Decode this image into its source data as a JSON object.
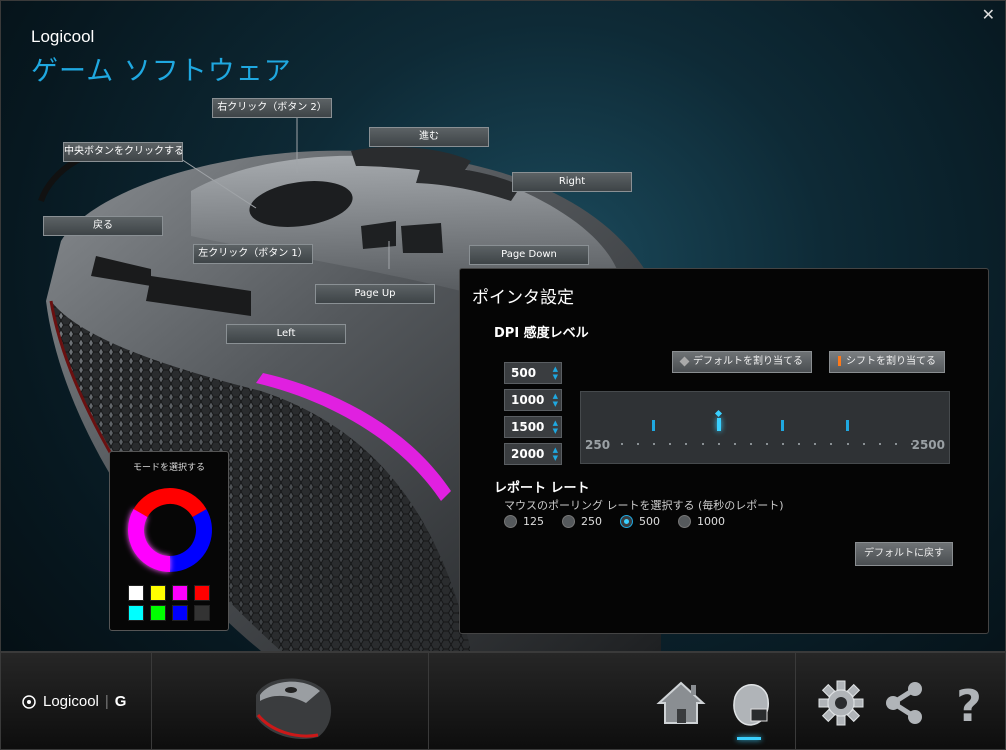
{
  "window": {
    "close_label": "✕"
  },
  "brand": {
    "company": "Logicool",
    "product": "ゲーム ソフトウェア"
  },
  "callouts": {
    "right_click": "右クリック（ボタン 2）",
    "forward": "進む",
    "middle_click": "中央ボタンをクリックする (7",
    "right": "Right",
    "back": "戻る",
    "left_click": "左クリック（ボタン 1）",
    "page_down": "Page Down",
    "page_up": "Page Up",
    "left": "Left"
  },
  "panel": {
    "title": "ポインタ設定",
    "dpi_title": "DPI 感度レベル",
    "assign_default_label": "デフォルトを割り当てる",
    "assign_shift_label": "シフトを割り当てる",
    "dpi_levels": [
      "500",
      "1000",
      "1500",
      "2000"
    ],
    "slider": {
      "min_label": "250",
      "max_label": "2500",
      "min": 250,
      "max": 2500,
      "step": 125,
      "levels": [
        500,
        1000,
        1500,
        2000
      ],
      "selected": 1000
    },
    "report_title": "レポート レート",
    "report_subtitle": "マウスのポーリング レートを選択する (毎秒のレポート)",
    "report_options": [
      "125",
      "250",
      "500",
      "1000"
    ],
    "report_selected": "500",
    "reset_label": "デフォルトに戻す"
  },
  "mode": {
    "title": "モードを選択する",
    "swatches": [
      "#ffffff",
      "#ffff00",
      "#ff00ff",
      "#ff0000",
      "#00ffff",
      "#00ff00",
      "#0000ff",
      "#333333"
    ]
  },
  "bottom": {
    "logo_text": "Logicool",
    "logo_g": "G",
    "icons": [
      "home-icon",
      "mouse-settings-icon",
      "settings-gear-icon",
      "share-icon",
      "help-icon"
    ]
  },
  "colors": {
    "accent": "#1fa8e0",
    "highlight": "#3ad0ff",
    "stripe": "#e020e0"
  }
}
